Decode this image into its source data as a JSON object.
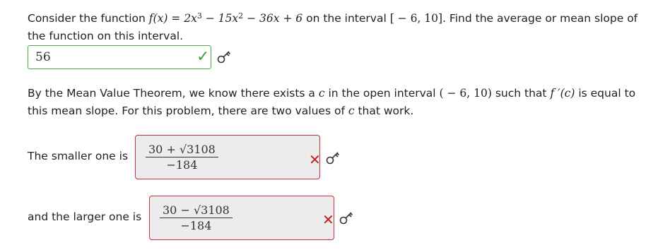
{
  "question1": {
    "intro": "Consider the function ",
    "func_lhs": "f(x) = 2x",
    "exp1": "3",
    "part2": " − 15x",
    "exp2": "2",
    "part3": " − 36x + 6",
    "mid": " on the interval ",
    "interval": "[ − 6, 10]",
    "ask": ". Find the average or mean slope of the function on this interval."
  },
  "answer1": {
    "value": "56",
    "status": "correct"
  },
  "question2": {
    "text1": "By the Mean Value Theorem, we know there exists a ",
    "c": "c",
    "text2": " in the open interval ",
    "interval": "( − 6, 10)",
    "text3": " such that ",
    "fprime": "f ′(c)",
    "text4": " is equal to this mean slope. For this problem, there are two values of ",
    "c2": "c",
    "text5": " that work."
  },
  "smaller": {
    "label": "The smaller one is",
    "numerator": "30 + √3108",
    "denominator": "−184",
    "status": "incorrect"
  },
  "larger": {
    "label": "and the larger one is",
    "numerator": "30 − √3108",
    "denominator": "−184",
    "status": "incorrect"
  },
  "icons": {
    "correct": "check-icon",
    "incorrect": "x-icon",
    "key": "key-icon"
  },
  "colors": {
    "correct": "#3aa33a",
    "incorrect": "#c81e1e"
  }
}
